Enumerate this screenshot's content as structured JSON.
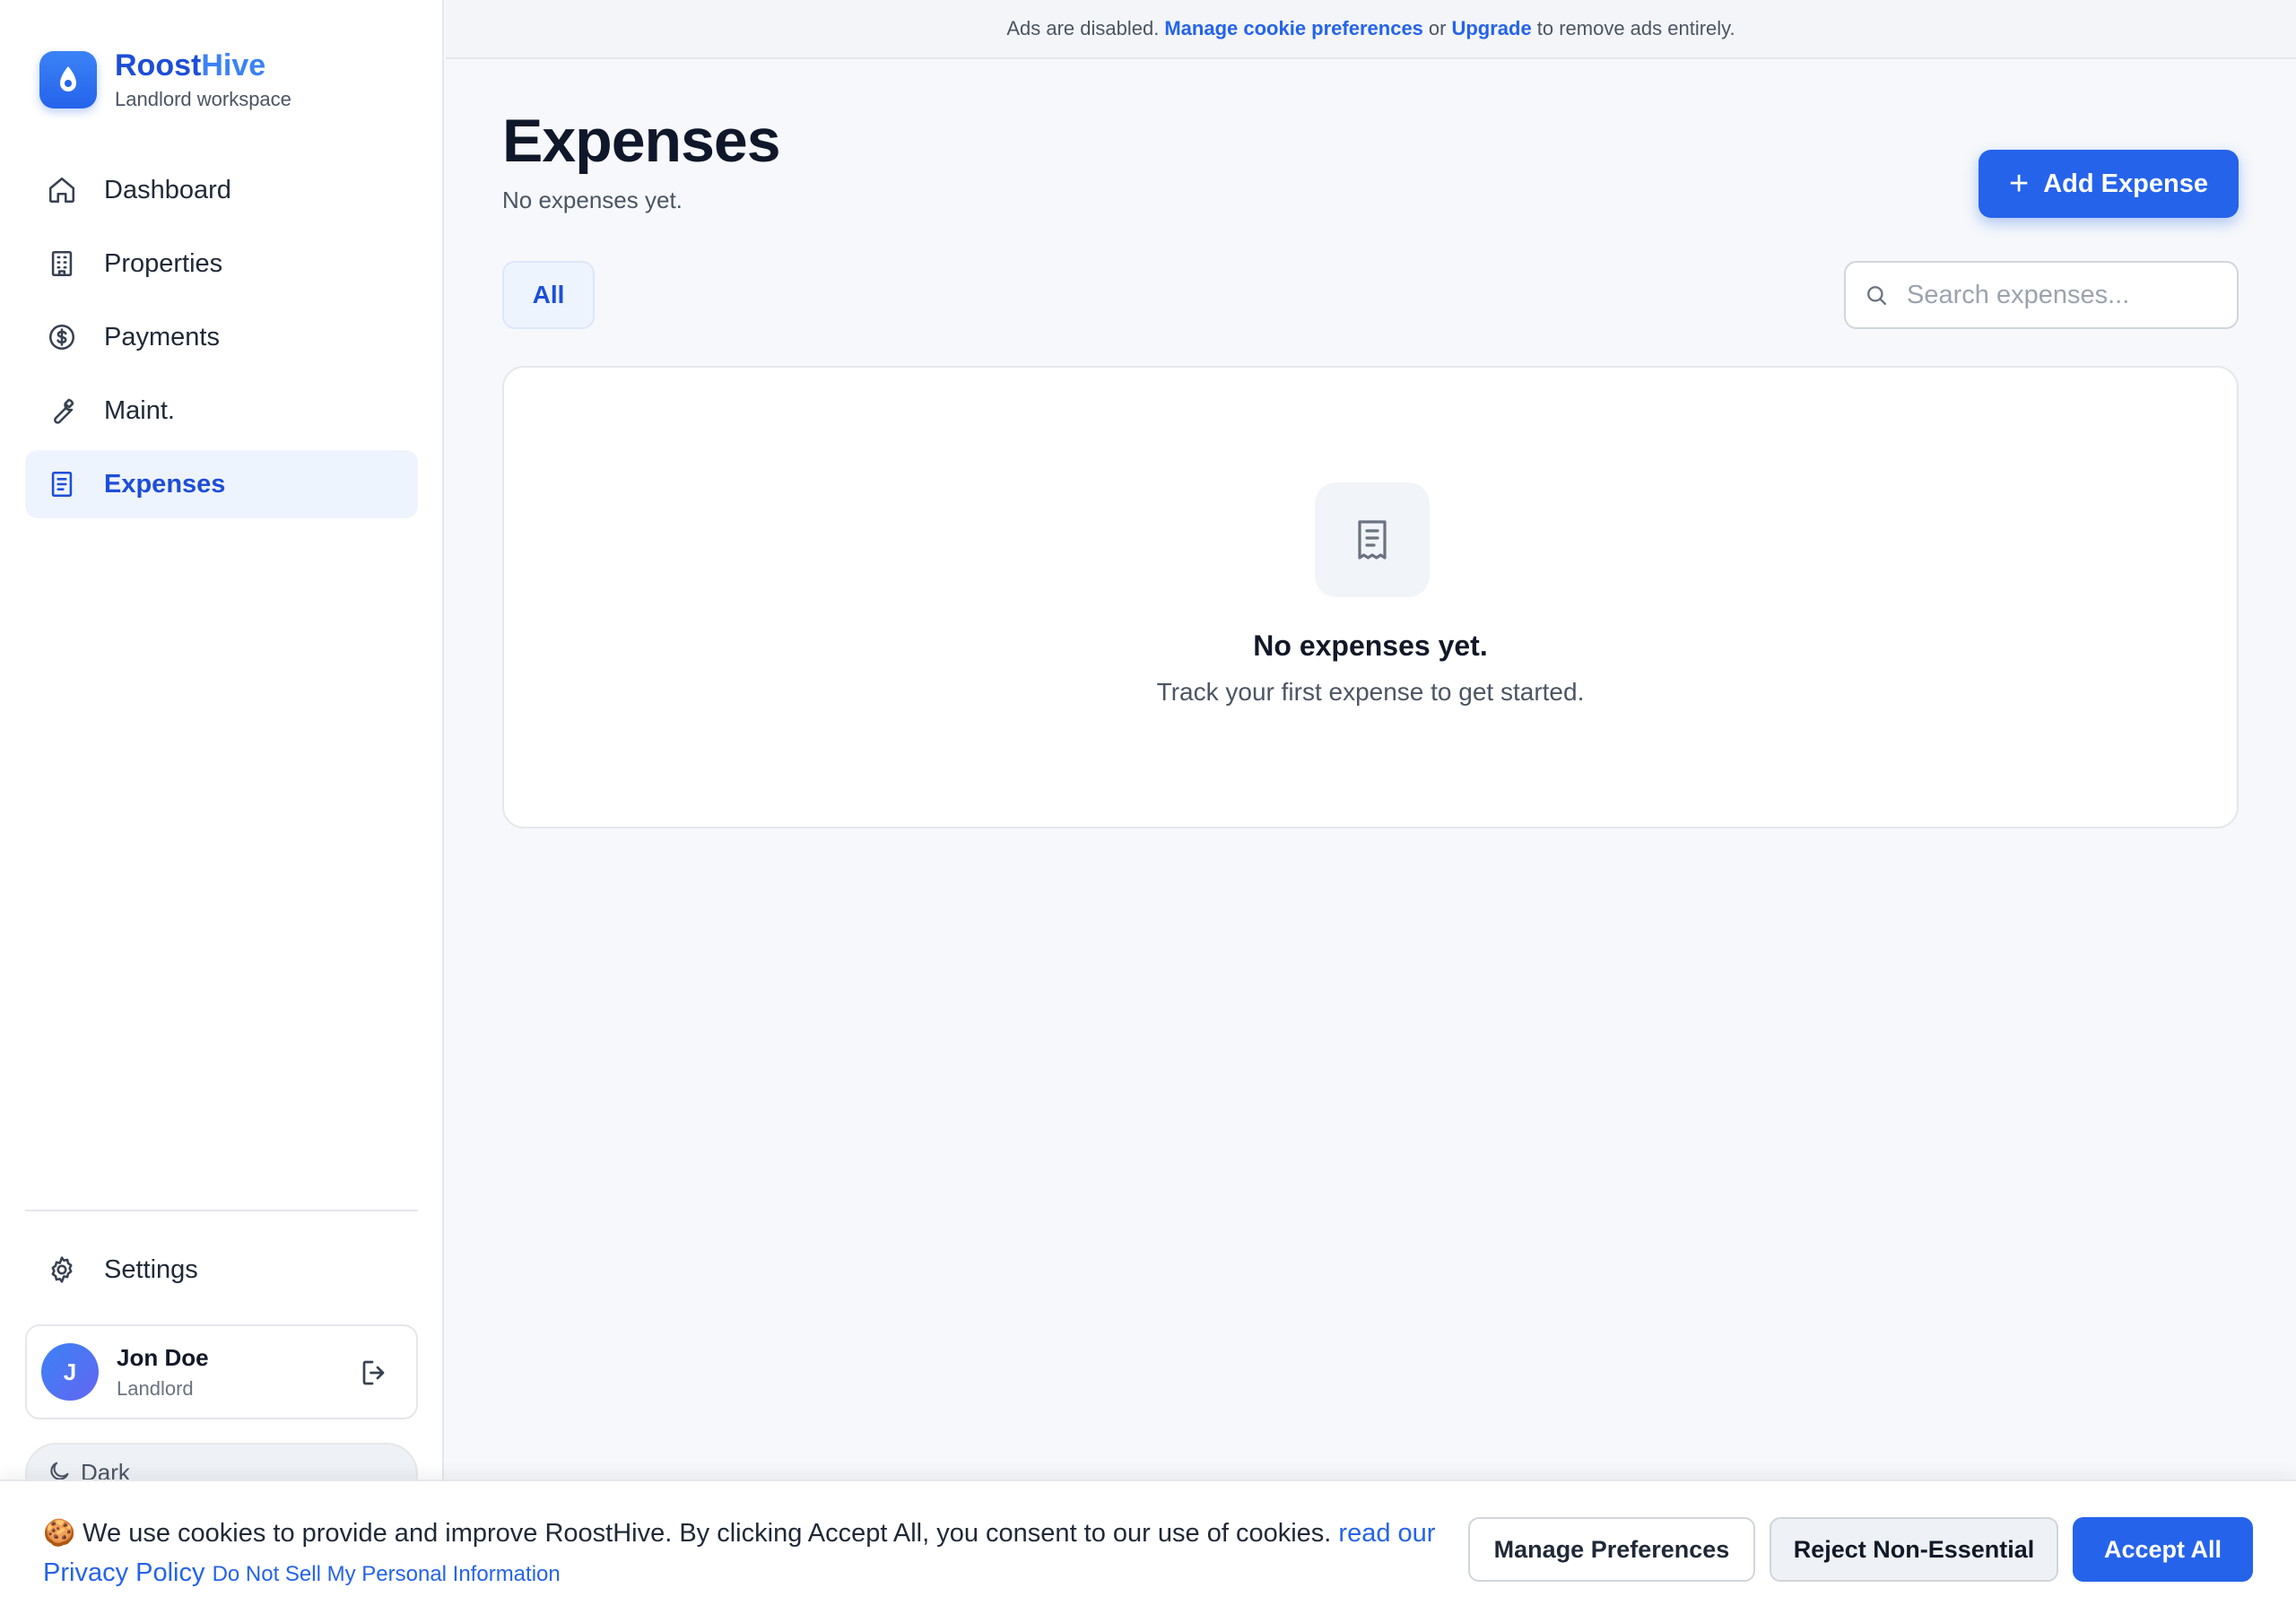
{
  "brand": {
    "name_part1": "Roost",
    "name_part2": "Hive",
    "subtitle": "Landlord workspace"
  },
  "nav": {
    "items": [
      {
        "label": "Dashboard",
        "icon": "home-icon"
      },
      {
        "label": "Properties",
        "icon": "building-icon"
      },
      {
        "label": "Payments",
        "icon": "dollar-circle-icon"
      },
      {
        "label": "Maint.",
        "icon": "wrench-icon"
      },
      {
        "label": "Expenses",
        "icon": "receipt-icon",
        "active": true
      }
    ],
    "settings_label": "Settings"
  },
  "user": {
    "initial": "J",
    "name": "Jon Doe",
    "role": "Landlord"
  },
  "theme_toggle": {
    "label": "Dark"
  },
  "adbar": {
    "prefix": "Ads are disabled.",
    "link1": "Manage cookie preferences",
    "middle": "or",
    "link2": "Upgrade",
    "suffix": "to remove ads entirely."
  },
  "main": {
    "title": "Expenses",
    "subtitle": "No expenses yet.",
    "add_button": "Add Expense",
    "filter_all": "All",
    "search_placeholder": "Search expenses...",
    "empty_title": "No expenses yet.",
    "empty_subtitle": "Track your first expense to get started."
  },
  "cookie": {
    "text": "🍪 We use cookies to provide and improve RoostHive. By clicking Accept All, you consent to our use of cookies.",
    "link_privacy": "read our Privacy Policy",
    "link_dnsmpi": "Do Not Sell My Personal Information",
    "manage_button": "Manage Preferences",
    "reject_button": "Reject Non-Essential",
    "accept_button": "Accept All"
  },
  "colors": {
    "accent": "#2563eb",
    "accent_soft": "#eef4fe",
    "text": "#111827",
    "muted": "#4b5563"
  }
}
